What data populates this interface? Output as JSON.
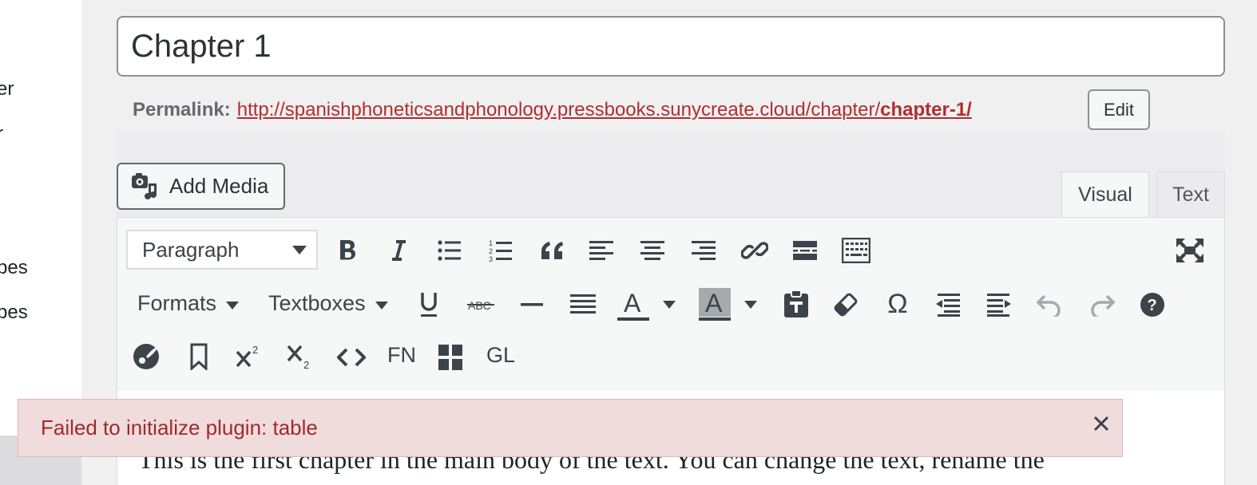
{
  "sidebar": {
    "items": [
      "er",
      "r",
      "pes",
      "pes"
    ]
  },
  "post": {
    "title": "Chapter 1"
  },
  "permalink": {
    "label": "Permalink:",
    "url_base": "http://spanishphoneticsandphonology.pressbooks.sunycreate.cloud/chapter/",
    "slug": "chapter-1/",
    "edit_label": "Edit"
  },
  "editor": {
    "add_media_label": "Add Media",
    "tabs": {
      "visual": "Visual",
      "text": "Text"
    },
    "active_tab": "visual",
    "toolbar": {
      "block_format": "Paragraph",
      "formats_label": "Formats",
      "textboxes_label": "Textboxes",
      "fn_label": "FN",
      "gl_label": "GL",
      "row1_icons": [
        "bold-icon",
        "italic-icon",
        "bullet-list-icon",
        "numbered-list-icon",
        "blockquote-icon",
        "align-left-icon",
        "align-center-icon",
        "align-right-icon",
        "link-icon",
        "read-more-icon",
        "toolbar-toggle-icon",
        "fullscreen-icon"
      ],
      "row2_icons": [
        "underline-icon",
        "strikethrough-icon",
        "horizontal-line-icon",
        "justify-icon",
        "text-color-icon",
        "background-color-icon",
        "paste-as-text-icon",
        "clear-formatting-icon",
        "special-character-icon",
        "outdent-icon",
        "indent-icon",
        "undo-icon",
        "redo-icon",
        "help-icon"
      ],
      "row3_icons": [
        "color-palette-icon",
        "anchor-bookmark-icon",
        "superscript-icon",
        "subscript-icon",
        "code-icon",
        "footnote-icon",
        "table-grid-icon",
        "glossary-icon"
      ]
    },
    "content_line": "This is the first chapter in the main body of the text. You can change the text, rename the"
  },
  "notice": {
    "message": "Failed to initialize plugin: table",
    "type": "error"
  },
  "colors": {
    "link": "#b32d2e",
    "notice_bg": "#f0dcdc",
    "notice_text": "#a12a2a",
    "text_color_underline": "#3c434a",
    "bg_color_swatch": "#a7aaad"
  }
}
